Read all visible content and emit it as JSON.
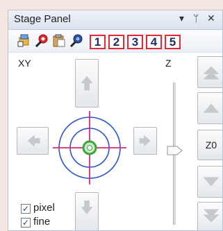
{
  "panel": {
    "title": "Stage Panel",
    "controls": {
      "menu": "▾",
      "pin": "ᛘ",
      "close": "✕"
    }
  },
  "toolbar": {
    "icons": [
      "settings-tool-icon",
      "pin-red-icon",
      "clipboard-icon",
      "pin-blue-icon"
    ],
    "number_buttons": [
      "1",
      "2",
      "3",
      "4",
      "5"
    ]
  },
  "xy": {
    "label": "XY"
  },
  "z": {
    "label": "Z",
    "value_label": "Z0"
  },
  "checkboxes": [
    {
      "label": "pixel",
      "checked": true
    },
    {
      "label": "fine",
      "checked": true
    }
  ],
  "colors": {
    "accent_red": "#e22a36",
    "crosshair_magenta": "#d8287c",
    "ring_blue": "#2a55d0",
    "center_green": "#3aa53a"
  }
}
